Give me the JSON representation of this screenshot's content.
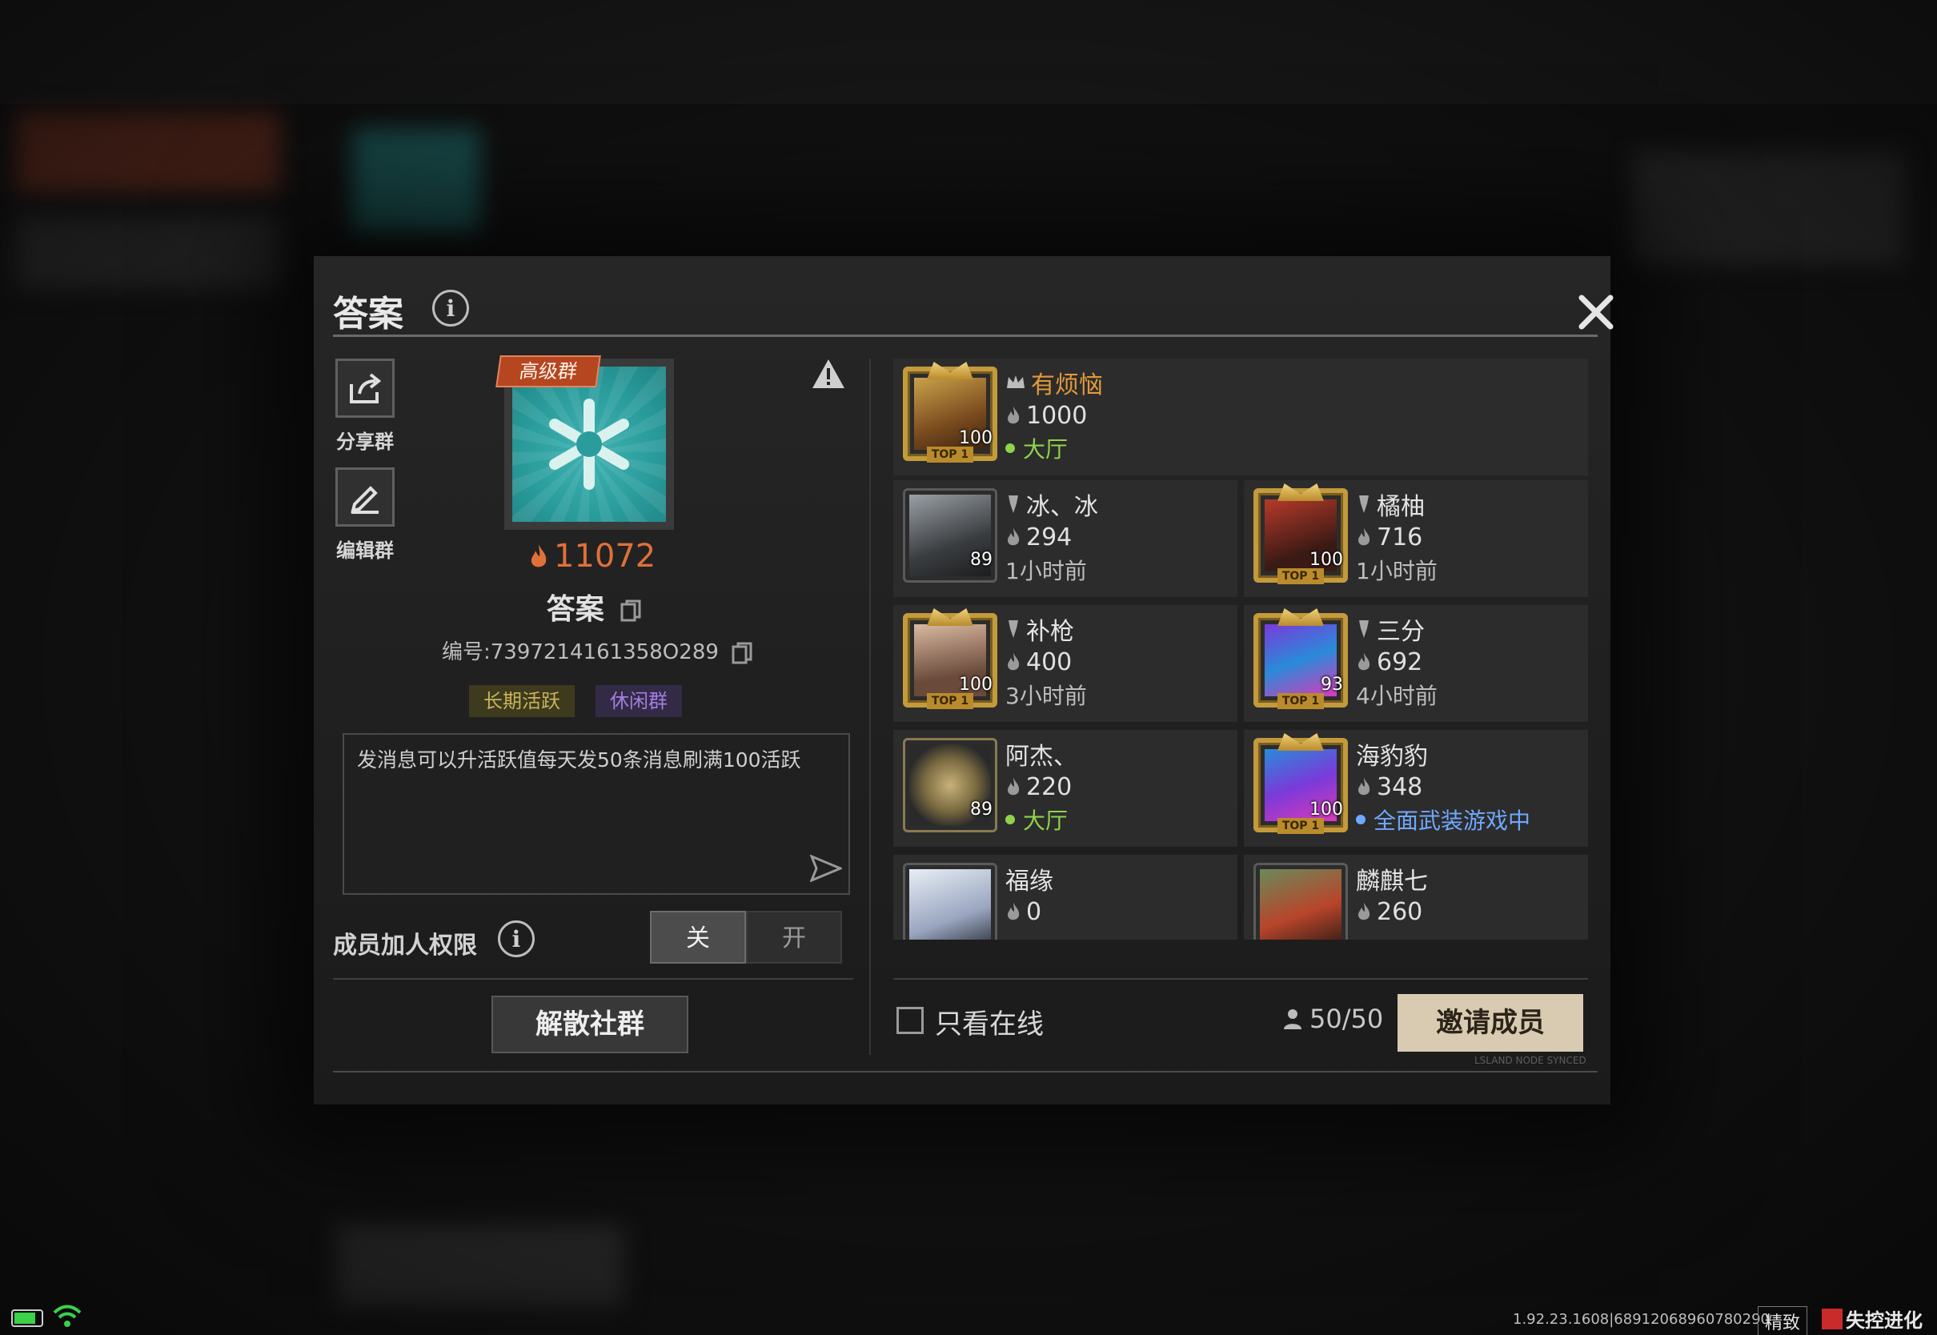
{
  "header": {
    "title": "答案"
  },
  "actions": {
    "share_label": "分享群",
    "edit_label": "编辑群"
  },
  "group": {
    "badge": "高级群",
    "heat": "11072",
    "name": "答案",
    "id_text": "编号:7397214161358O289",
    "tags": [
      "长期活跃",
      "休闲群"
    ],
    "message": "发消息可以升活跃值每天发50条消息刷满100活跃"
  },
  "permission": {
    "label": "成员加人权限",
    "off_label": "关",
    "on_label": "开",
    "selected": "关"
  },
  "dissolve_label": "解散社群",
  "owner": {
    "name": "有烦恼",
    "heat": "1000",
    "status": "大厅",
    "level": "100"
  },
  "members": [
    {
      "name": "冰、冰",
      "heat": "294",
      "status": "1小时前",
      "level": "89"
    },
    {
      "name": "橘柚",
      "heat": "716",
      "status": "1小时前",
      "level": "100"
    },
    {
      "name": "补枪",
      "heat": "400",
      "status": "3小时前",
      "level": "100"
    },
    {
      "name": "三分",
      "heat": "692",
      "status": "4小时前",
      "level": "93"
    },
    {
      "name": "阿杰、",
      "heat": "220",
      "status": "大厅",
      "level": "89"
    },
    {
      "name": "海豹豹",
      "heat": "348",
      "status": "全面武装游戏中",
      "level": "100"
    },
    {
      "name": "福缘",
      "heat": "0",
      "status": "",
      "level": ""
    },
    {
      "name": "麟麒七",
      "heat": "260",
      "status": "",
      "level": ""
    }
  ],
  "footer": {
    "online_only_label": "只看在线",
    "member_count": "50/50",
    "invite_label": "邀请成员",
    "sync_text": "LSLAND NODE SYNCED"
  },
  "system": {
    "version": "1.92.23.1608|68912068960780290",
    "quality": "精致",
    "brand": "失控进化"
  },
  "colors": {
    "accent_orange": "#e0703a",
    "owner_name": "#e39a3a",
    "online_green": "#8fd34a",
    "ingame_blue": "#6fa8ff",
    "invite_bg": "#d9cbb1"
  }
}
